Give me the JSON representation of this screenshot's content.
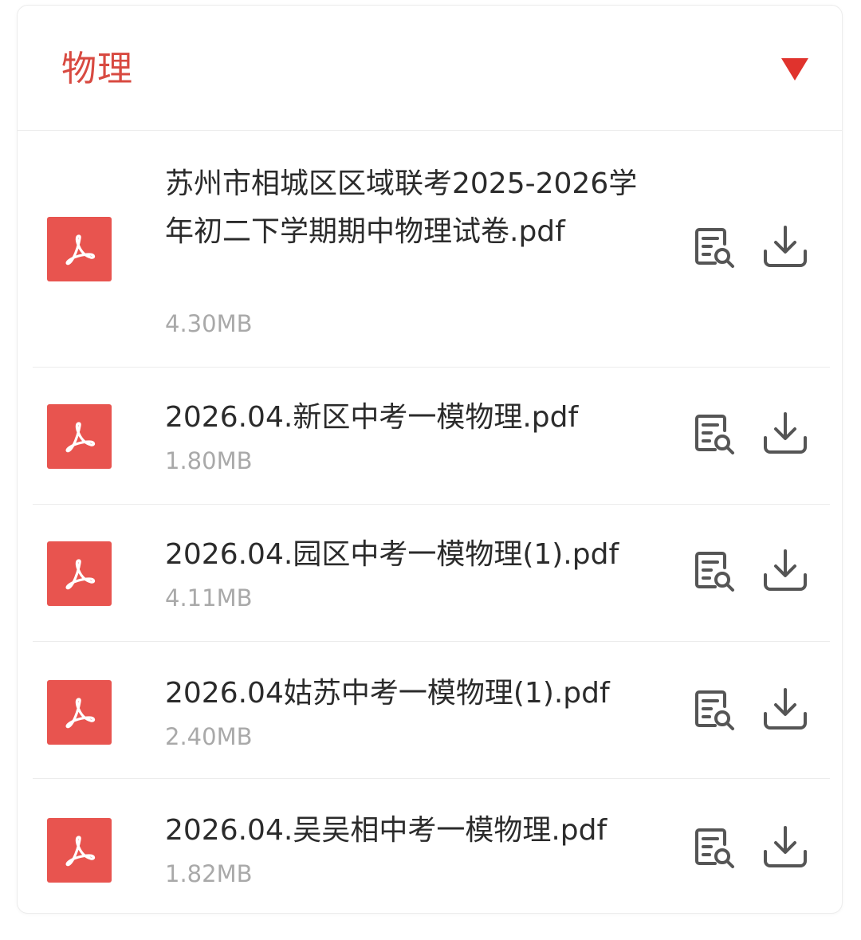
{
  "section": {
    "title": "物理",
    "accent_color": "#d84a41",
    "toggle_icon": "triangle-down-icon"
  },
  "files": [
    {
      "name": "苏州市相城区区域联考2025-2026学年初二下学期期中物理试卷.pdf",
      "size": "4.30MB"
    },
    {
      "name": "2026.04.新区中考一模物理.pdf",
      "size": "1.80MB"
    },
    {
      "name": "2026.04.园区中考一模物理(1).pdf",
      "size": "4.11MB"
    },
    {
      "name": "2026.04姑苏中考一模物理(1).pdf",
      "size": "2.40MB"
    },
    {
      "name": "2026.04.吴吴相中考一模物理.pdf",
      "size": "1.82MB"
    }
  ],
  "icons": {
    "file_type": "pdf-file-icon",
    "preview": "preview-document-icon",
    "download": "download-icon"
  },
  "colors": {
    "pdf_icon_bg": "#e8544f",
    "file_name": "#2b2b2b",
    "file_size": "#a9a9a9",
    "action_icon": "#555555"
  }
}
